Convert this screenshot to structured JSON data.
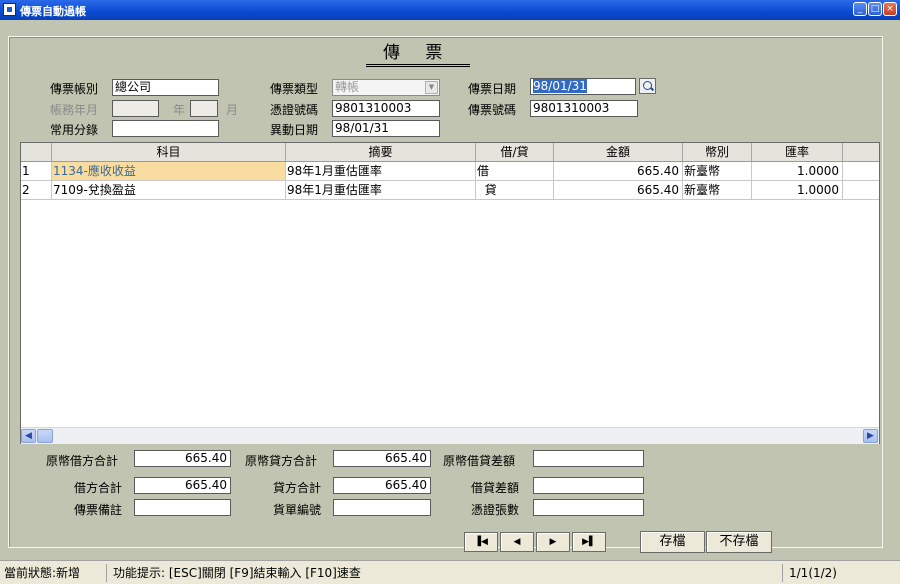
{
  "window": {
    "title": "傳票自動過帳"
  },
  "form": {
    "heading": "傳  票",
    "labels": {
      "account_book": "傳票帳別",
      "voucher_type": "傳票類型",
      "voucher_date": "傳票日期",
      "close_month": "帳務年月",
      "year": "年",
      "month": "月",
      "evidence_no": "憑證號碼",
      "voucher_no": "傳票號碼",
      "common_category": "常用分錄",
      "change_date": "異動日期"
    },
    "values": {
      "account_book": "總公司",
      "voucher_type": "轉帳",
      "voucher_date": "98/01/31",
      "close_year": "",
      "close_month": "",
      "evidence_no": "9801310003",
      "voucher_no": "9801310003",
      "common_category": "",
      "change_date": "98/01/31"
    }
  },
  "grid": {
    "columns": [
      "科目",
      "摘要",
      "借/貸",
      "金額",
      "幣別",
      "匯率"
    ],
    "rows": [
      {
        "n": "1",
        "account": "1134-應收收益",
        "summary": "98年1月重估匯率",
        "dc": "借",
        "amount": "665.40",
        "currency": "新臺幣",
        "rate": "1.0000"
      },
      {
        "n": "2",
        "account": "7109-兌換盈益",
        "summary": "98年1月重估匯率",
        "dc": "  貸",
        "amount": "665.40",
        "currency": "新臺幣",
        "rate": "1.0000"
      }
    ]
  },
  "totals": {
    "labels": {
      "orig_debit": "原幣借方合計",
      "orig_credit": "原幣貸方合計",
      "orig_diff": "原幣借貸差額",
      "debit": "借方合計",
      "credit": "貸方合計",
      "diff": "借貸差額",
      "remark": "傳票備註",
      "bill_no": "貨單編號",
      "evidence_count": "憑證張數"
    },
    "values": {
      "orig_debit": "665.40",
      "orig_credit": "665.40",
      "orig_diff": "",
      "debit": "665.40",
      "credit": "665.40",
      "diff": "",
      "remark": "",
      "bill_no": "",
      "evidence_count": ""
    }
  },
  "buttons": {
    "save": "存檔",
    "cancel": "不存檔"
  },
  "status": {
    "state": "當前狀態:新增",
    "hint": "功能提示: [ESC]關閉 [F9]結束輸入 [F10]速查",
    "page": "1/1(1/2)"
  },
  "colors": {
    "title_bar": "#0a4ad0",
    "client_bg": "#c0c4b0",
    "selected_cell": "#f8dca0"
  }
}
